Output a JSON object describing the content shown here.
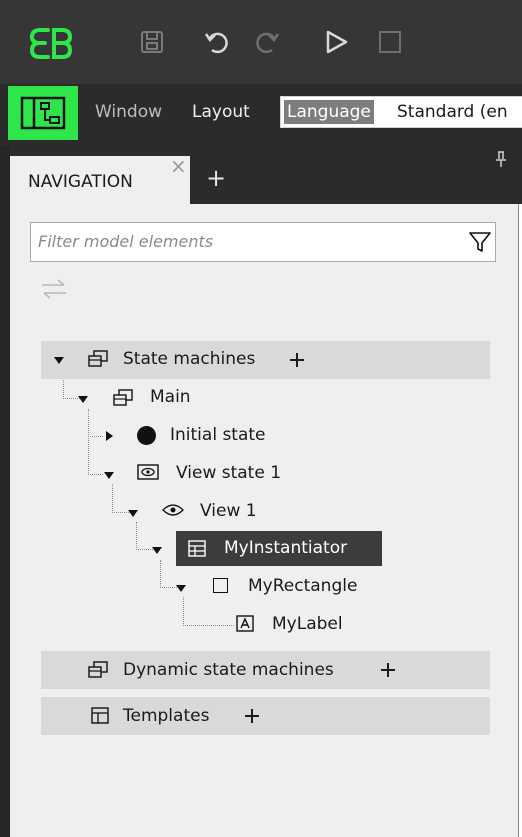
{
  "colors": {
    "toolbar_bg": "#363636",
    "menubar_bg": "#2b2b2b",
    "accent_green": "#2ee64a",
    "panel_bg": "#efefef",
    "section_bg": "#d9d9d9",
    "selected_bg": "#3c3c3c"
  },
  "toolbar": {
    "icons": [
      "app-logo-icon",
      "save-icon",
      "undo-icon",
      "redo-icon",
      "play-icon",
      "stop-icon"
    ]
  },
  "menubar": {
    "window_label": "Window",
    "layout_label": "Layout",
    "language_label": "Language",
    "language_value": "Standard (en"
  },
  "tabs": {
    "navigation_label": "NAVIGATION",
    "close_glyph": "×",
    "add_glyph": "+",
    "pin_glyph": "ᵖ"
  },
  "filter": {
    "placeholder": "Filter model elements"
  },
  "tree": {
    "state_machines": "State machines",
    "main": "Main",
    "initial_state": "Initial state",
    "view_state_1": "View state 1",
    "view_1": "View 1",
    "my_instantiator": "MyInstantiator",
    "my_rectangle": "MyRectangle",
    "my_label": "MyLabel",
    "dynamic_state_machines": "Dynamic state machines",
    "templates": "Templates"
  }
}
